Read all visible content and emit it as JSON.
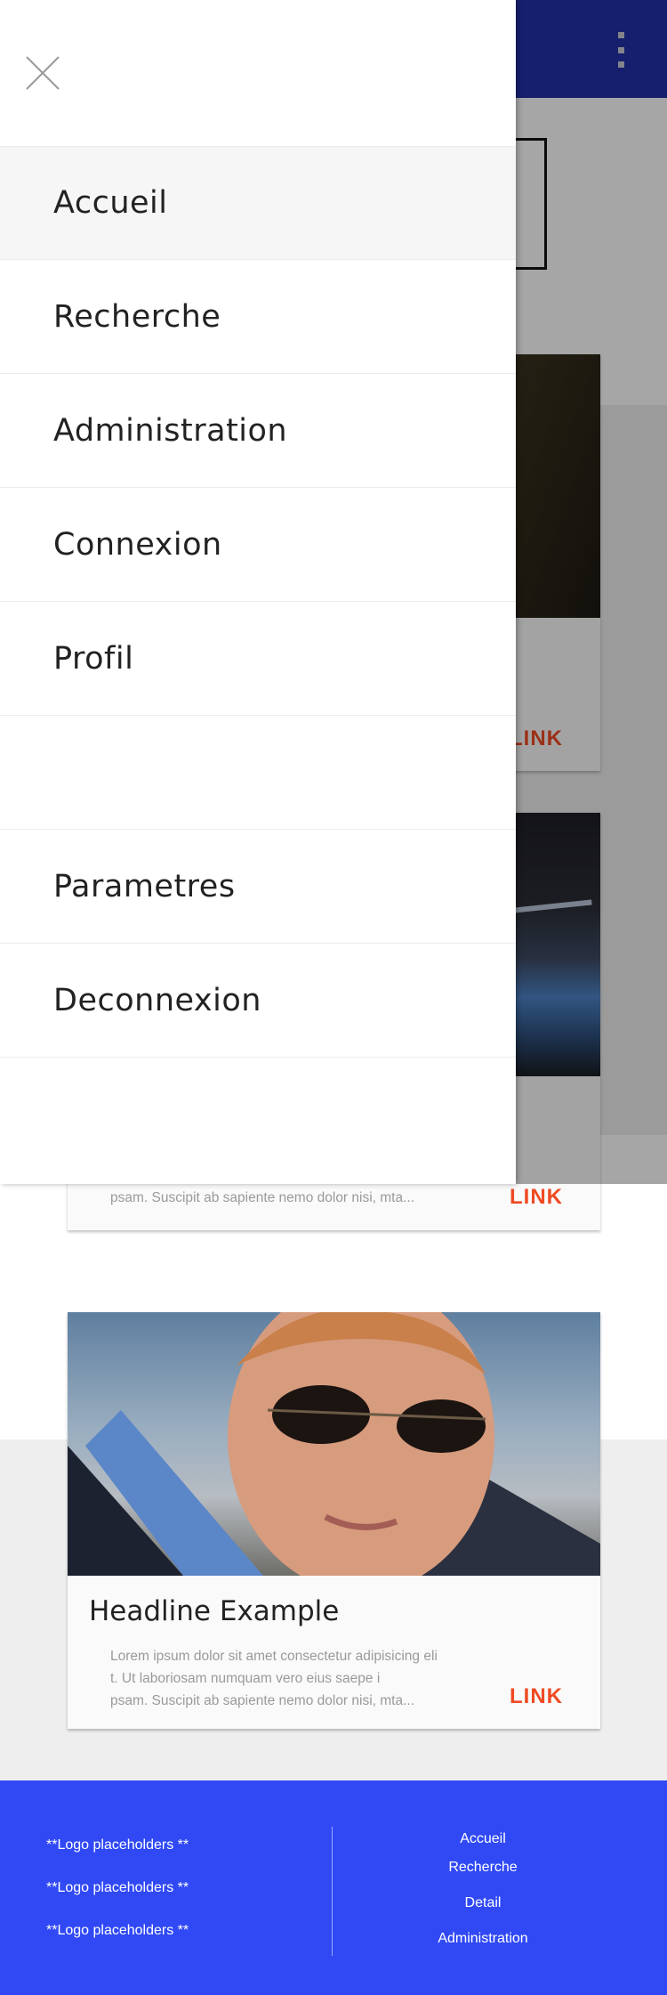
{
  "drawer": {
    "menu": [
      {
        "label": "Accueil",
        "active": true
      },
      {
        "label": "Recherche"
      },
      {
        "label": "Administration"
      },
      {
        "label": "Connexion"
      },
      {
        "label": "Profil"
      },
      {
        "label": ""
      },
      {
        "label": "Parametres"
      },
      {
        "label": "Deconnexion"
      }
    ]
  },
  "cards": [
    {
      "headline": "",
      "body": "",
      "link": "LINK"
    },
    {
      "headline": "",
      "body": "psam. Suscipit ab sapiente nemo dolor nisi, mta...",
      "link": "LINK"
    },
    {
      "headline": "Headline Example",
      "body_lines": [
        "Lorem ipsum dolor sit amet consectetur adipisicing eli",
        "t. Ut laboriosam numquam vero eius saepe i",
        "psam. Suscipit ab sapiente nemo dolor nisi, mta..."
      ],
      "link": "LINK"
    }
  ],
  "footer": {
    "logos": [
      "**Logo placeholders **",
      "**Logo placeholders **",
      "**Logo placeholders **"
    ],
    "links": [
      "Accueil",
      "Recherche",
      "Detail",
      "Administration"
    ]
  },
  "colors": {
    "topbar": "#2230a8",
    "footer": "#3049f5",
    "link": "#ef4a23"
  }
}
